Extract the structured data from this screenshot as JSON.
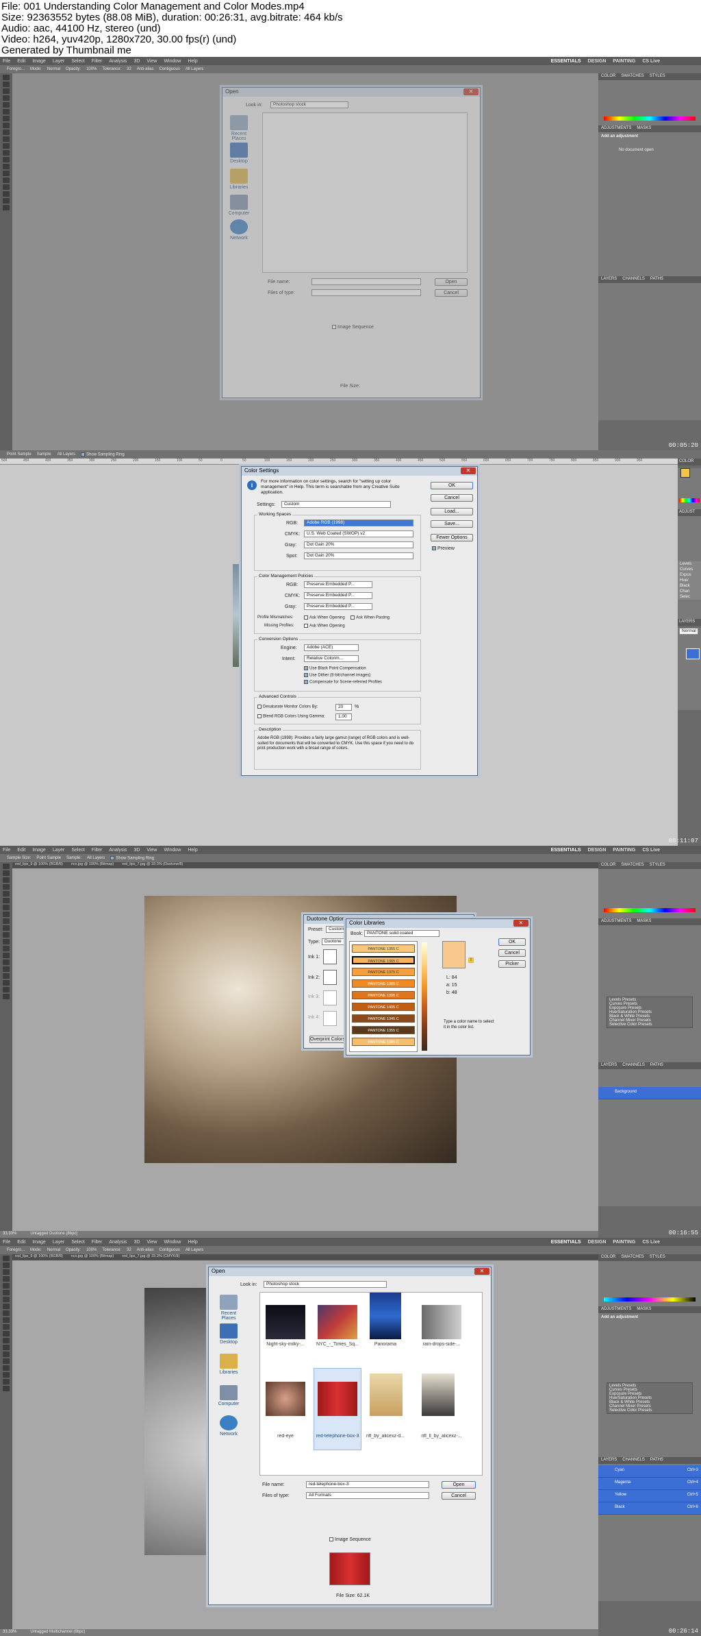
{
  "header": {
    "lines": [
      "File: 001 Understanding Color Management and Color Modes.mp4",
      "Size: 92363552 bytes (88.08 MiB), duration: 00:26:31, avg.bitrate: 464 kb/s",
      "Audio: aac, 44100 Hz, stereo (und)",
      "Video: h264, yuv420p, 1280x720, 30.00 fps(r) (und)",
      "Generated by Thumbnail me"
    ]
  },
  "app": {
    "menus": [
      "File",
      "Edit",
      "Image",
      "Layer",
      "Select",
      "Filter",
      "Analysis",
      "3D",
      "View",
      "Window",
      "Help"
    ],
    "workspaces": [
      "ESSENTIALS",
      "DESIGN",
      "PAINTING"
    ],
    "cslive": "CS Live"
  },
  "frames": [
    {
      "timestamp": "00:05:20",
      "options": [
        "Foregro...",
        "Mode:",
        "Normal",
        "Opacity:",
        "100%",
        "Tolerance:",
        "32",
        "Anti-alias",
        "Contiguous",
        "All Layers"
      ],
      "panels": {
        "color_tabs": [
          "COLOR",
          "SWATCHES",
          "STYLES"
        ],
        "adj_tabs": [
          "ADJUSTMENTS",
          "MASKS"
        ],
        "adj_title": "Add an adjustment",
        "adj_note": "No document open",
        "layer_tabs": [
          "LAYERS",
          "CHANNELS",
          "PATHS"
        ]
      },
      "dialog": {
        "title": "Open",
        "look_in": "Look in:",
        "folder": "Photoshop stock",
        "places": [
          "Recent Places",
          "Desktop",
          "Libraries",
          "Computer",
          "Network"
        ],
        "file_name": "File name:",
        "files_of_type": "Files of type:",
        "open": "Open",
        "cancel": "Cancel",
        "image_sequence": "Image Sequence",
        "file_size": "File Size:"
      }
    },
    {
      "timestamp": "00:11:07",
      "options": [
        "Point Sample",
        "Sample:",
        "All Layers",
        "Show Sampling Ring"
      ],
      "ruler": [
        "500",
        "450",
        "400",
        "350",
        "300",
        "250",
        "200",
        "150",
        "100",
        "50",
        "0",
        "50",
        "100",
        "150",
        "200",
        "250",
        "300",
        "350",
        "400",
        "450",
        "500",
        "550",
        "600",
        "650",
        "700",
        "750",
        "800",
        "850",
        "900",
        "950"
      ],
      "dialog": {
        "title": "Color Settings",
        "info": "For more information on color settings, search for \"setting up color management\" in Help. This term is searchable from any Creative Suite application.",
        "settings_label": "Settings:",
        "settings_value": "Custom",
        "working_spaces": "Working Spaces",
        "ws_rows": [
          {
            "label": "RGB:",
            "value": "Adobe RGB (1998)"
          },
          {
            "label": "CMYK:",
            "value": "U.S. Web Coated (SWOP) v2"
          },
          {
            "label": "Gray:",
            "value": "Dot Gain 20%"
          },
          {
            "label": "Spot:",
            "value": "Dot Gain 20%"
          }
        ],
        "policies": "Color Management Policies",
        "pol_rows": [
          {
            "label": "RGB:",
            "value": "Preserve Embedded P..."
          },
          {
            "label": "CMYK:",
            "value": "Preserve Embedded P..."
          },
          {
            "label": "Gray:",
            "value": "Preserve Embedded P..."
          }
        ],
        "mismatch_label": "Profile Mismatches:",
        "ask_opening": "Ask When Opening",
        "ask_pasting": "Ask When Pasting",
        "missing_label": "Missing Profiles:",
        "conversion": "Conversion Options",
        "engine_label": "Engine:",
        "engine_value": "Adobe (ACE)",
        "intent_label": "Intent:",
        "intent_value": "Relative Colorim...",
        "conv_checks": [
          "Use Black Point Compensation",
          "Use Dither (8-bit/channel images)",
          "Compensate for Scene-referred Profiles"
        ],
        "advanced": "Advanced Controls",
        "desat": "Desaturate Monitor Colors By:",
        "desat_value": "20",
        "percent": "%",
        "blend": "Blend RGB Colors Using Gamma:",
        "blend_value": "1.00",
        "desc_title": "Description",
        "desc": "Adobe RGB (1998): Provides a fairly large gamut (range) of RGB colors and is well-suited for documents that will be converted to CMYK. Use this space if you need to do print production work with a broad range of colors.",
        "buttons": [
          "OK",
          "Cancel",
          "Load...",
          "Save...",
          "Fewer Options"
        ],
        "preview": "Preview"
      },
      "right_items": [
        "Levels",
        "Curves",
        "Expos",
        "Hue/",
        "Black",
        "Chan",
        "Selec"
      ],
      "right_tabs": [
        "COLOR",
        "ADJUST",
        "LAYERS"
      ],
      "right_mode": "Normal"
    },
    {
      "timestamp": "00:16:55",
      "options": [
        "Sample Size:",
        "Point Sample",
        "Sample:",
        "All Layers",
        "Show Sampling Ring"
      ],
      "doc_tabs": [
        "red_lips_9 @ 100% (RGB/8)",
        "ncx.jpg @ 100% (Bitmap)",
        "red_lips_7.jpg @ 33.3% (Duotone/8)"
      ],
      "status": "33.33%",
      "status_doc": "Untagged Duotone (8bpc)",
      "duotone": {
        "title": "Duotone Options",
        "preset": "Preset:",
        "preset_value": "Custom",
        "type": "Type:",
        "type_value": "Duotone",
        "inks": [
          "Ink 1:",
          "Ink 2:",
          "Ink 3:",
          "Ink 4:"
        ],
        "overprint": "Overprint Colors..."
      },
      "libraries": {
        "title": "Color Libraries",
        "book_label": "Book:",
        "book_value": "PANTONE solid coated",
        "swatches": [
          "PANTONE 1355 C",
          "PANTONE 1365 C",
          "PANTONE 1375 C",
          "PANTONE 1385 C",
          "PANTONE 1395 C",
          "PANTONE 1405 C",
          "PANTONE 1345 C",
          "PANTONE 1355 C",
          "PANTONE 1365 C"
        ],
        "lab": [
          {
            "k": "L:",
            "v": "84"
          },
          {
            "k": "a:",
            "v": "15"
          },
          {
            "k": "b:",
            "v": "48"
          }
        ],
        "hint": "Type a color name to select it in the color list.",
        "buttons": [
          "OK",
          "Cancel",
          "Picker"
        ]
      },
      "presets": [
        "Levels Presets",
        "Curves Presets",
        "Exposure Presets",
        "Hue/Saturation Presets",
        "Black & White Presets",
        "Channel Mixer Presets",
        "Selective Color Presets"
      ],
      "layer": "Background"
    },
    {
      "timestamp": "00:26:14",
      "options": [
        "Foregro...",
        "Mode:",
        "Normal",
        "Opacity:",
        "100%",
        "Tolerance:",
        "32",
        "Anti-alias",
        "Contiguous",
        "All Layers"
      ],
      "doc_tabs": [
        "red_lips_9 @ 100% (RGB/8)",
        "ncx.jpg @ 100% (Bitmap)",
        "red_lips_7.jpg @ 33.3% (CMYK/8)"
      ],
      "status": "33.33%",
      "status_doc": "Untagged Multichannel (8bpc)",
      "dialog": {
        "title": "Open",
        "look_in": "Look in:",
        "folder": "Photoshop stock",
        "places": [
          "Recent Places",
          "Desktop",
          "Libraries",
          "Computer",
          "Network"
        ],
        "files": [
          "Night-sky-milky-...",
          "NYC_-_Times_Sq...",
          "Panorama",
          "rain-drops-side-...",
          "red-eye",
          "red-telephone-box-3",
          "rifl_by_alicexz-d...",
          "rifl_ll_by_alicexz-..."
        ],
        "file_name_label": "File name:",
        "file_name_value": "red-telephone-box-3",
        "files_of_type_label": "Files of type:",
        "files_of_type_value": "All Formats",
        "open": "Open",
        "cancel": "Cancel",
        "image_sequence": "Image Sequence",
        "file_size": "File Size: 62.1K"
      },
      "channels": [
        {
          "name": "Cyan",
          "key": "Ctrl+3"
        },
        {
          "name": "Magenta",
          "key": "Ctrl+4"
        },
        {
          "name": "Yellow",
          "key": "Ctrl+5"
        },
        {
          "name": "Black",
          "key": "Ctrl+6"
        }
      ],
      "adj_title": "Add an adjustment"
    }
  ]
}
